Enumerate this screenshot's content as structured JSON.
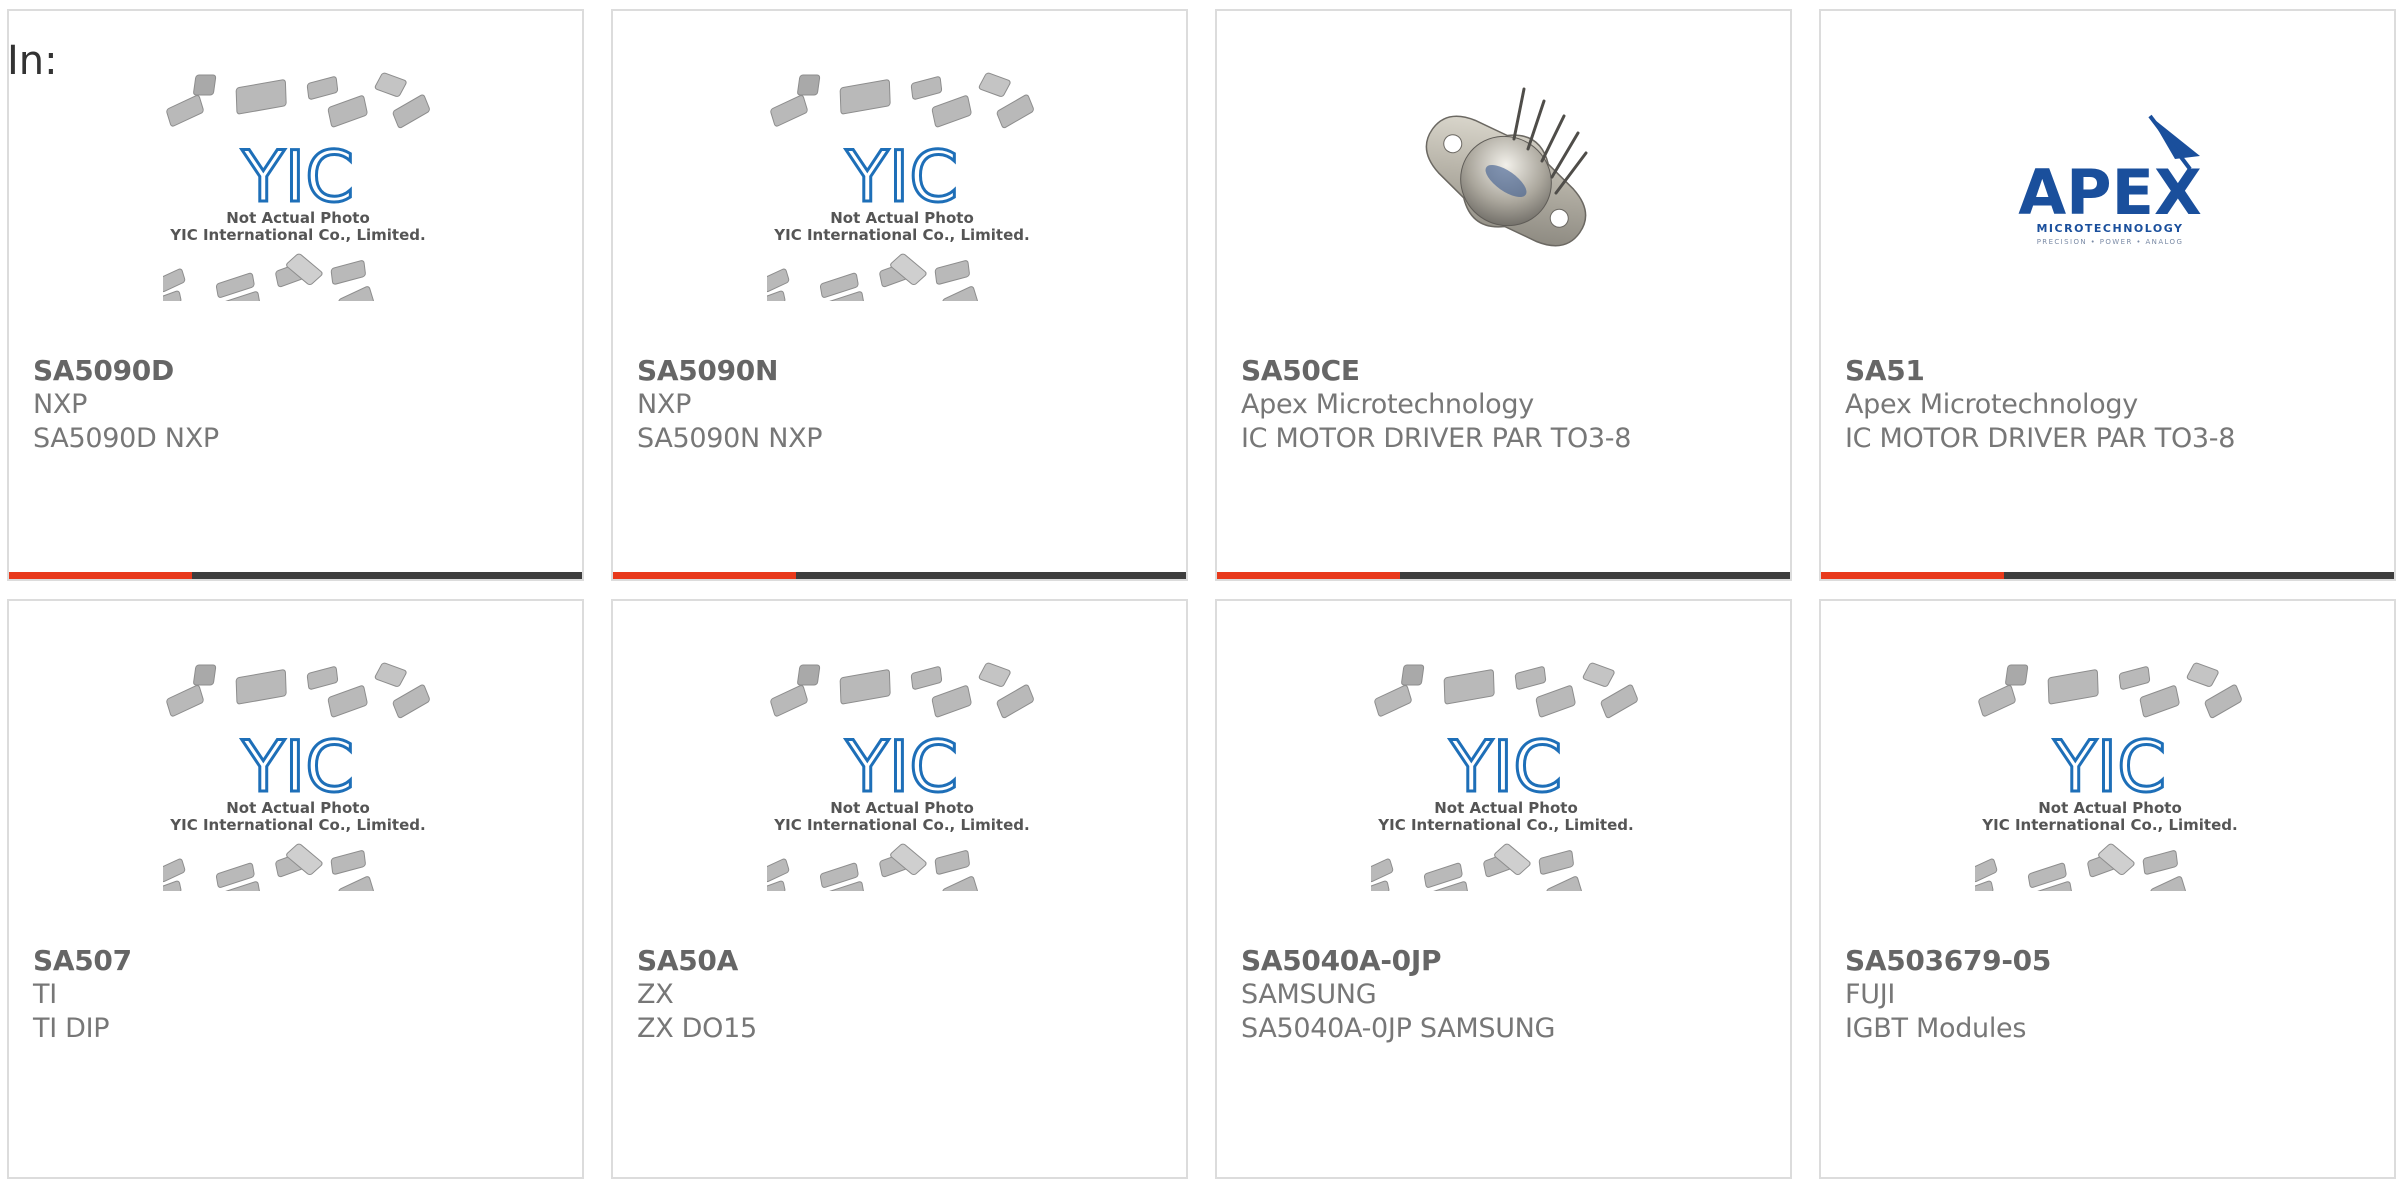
{
  "header": {
    "label": "In:"
  },
  "colors": {
    "accent": "#e8391b",
    "bar": "#3d3d3d",
    "border": "#dcdcdc",
    "yic_blue": "#1e6fb8",
    "apex_blue": "#1a4f9c"
  },
  "placeholder": {
    "line1": "Not Actual Photo",
    "line2": "YIC International Co., Limited.",
    "logo": "YIC"
  },
  "apex": {
    "logo": "APEX",
    "tagline": "MICROTECHNOLOGY",
    "subtag": "PRECISION • POWER • ANALOG"
  },
  "products": [
    {
      "part": "SA5090D",
      "manufacturer": "NXP",
      "description": "SA5090D NXP",
      "image": "placeholder"
    },
    {
      "part": "SA5090N",
      "manufacturer": "NXP",
      "description": "SA5090N NXP",
      "image": "placeholder"
    },
    {
      "part": "SA50CE",
      "manufacturer": "Apex Microtechnology",
      "description": "IC MOTOR DRIVER PAR TO3-8",
      "image": "to3-package"
    },
    {
      "part": "SA51",
      "manufacturer": "Apex Microtechnology",
      "description": "IC MOTOR DRIVER PAR TO3-8",
      "image": "apex-logo"
    },
    {
      "part": "SA507",
      "manufacturer": "TI",
      "description": "TI DIP",
      "image": "placeholder"
    },
    {
      "part": "SA50A",
      "manufacturer": "ZX",
      "description": "ZX DO15",
      "image": "placeholder"
    },
    {
      "part": "SA5040A-0JP",
      "manufacturer": "SAMSUNG",
      "description": "SA5040A-0JP SAMSUNG",
      "image": "placeholder"
    },
    {
      "part": "SA503679-05",
      "manufacturer": "FUJI",
      "description": "IGBT Modules",
      "image": "placeholder"
    }
  ]
}
